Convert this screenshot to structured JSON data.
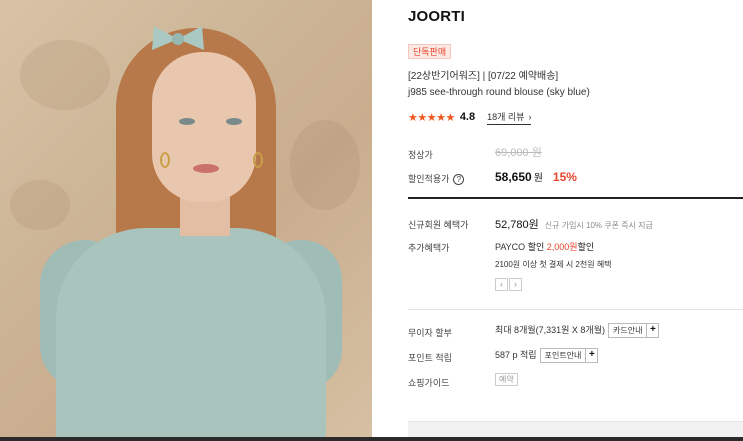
{
  "product": {
    "brand": "JOORTI",
    "badge": "단독판매",
    "subtitle": "[22상반기어워즈] | [07/22 예약배송]",
    "name": "j985 see-through round blouse (sky blue)",
    "rating": {
      "stars": "★★★★★",
      "score": "4.8",
      "reviews_label": "18개 리뷰",
      "reviews_chevron": "›"
    }
  },
  "pricing": {
    "regular_label": "정상가",
    "regular_value": "69,000 원",
    "sale_label": "할인적용가",
    "help_icon": "?",
    "sale_value": "58,650",
    "sale_unit": "원",
    "discount": "15%"
  },
  "benefits": {
    "member_label": "신규회원 혜택가",
    "member_price": "52,780원",
    "member_note": "신규 가입시 10% 쿠폰 즉시 지급",
    "extra_label": "추가혜택가",
    "payco_prefix": "PAYCO",
    "payco_mid": "할인",
    "payco_amount": "2,000원",
    "payco_suffix": "할인",
    "payco_note": "2100원 이상 첫 결제 시 2천원 혜택",
    "pager_prev": "‹",
    "pager_next": "›"
  },
  "options": {
    "installment_label": "무이자 할부",
    "installment_value": "최대 8개월(7,331원 X 8개월)",
    "card_info_button": "카드안내",
    "points_label": "포인트 적립",
    "points_value": "587 p 적립",
    "points_info_button": "포인트안내",
    "plus": "+",
    "guide_label": "쇼핑가이드",
    "guide_tag": "예약"
  },
  "colors": {
    "accent": "#e8452c",
    "star": "#f0571e"
  }
}
